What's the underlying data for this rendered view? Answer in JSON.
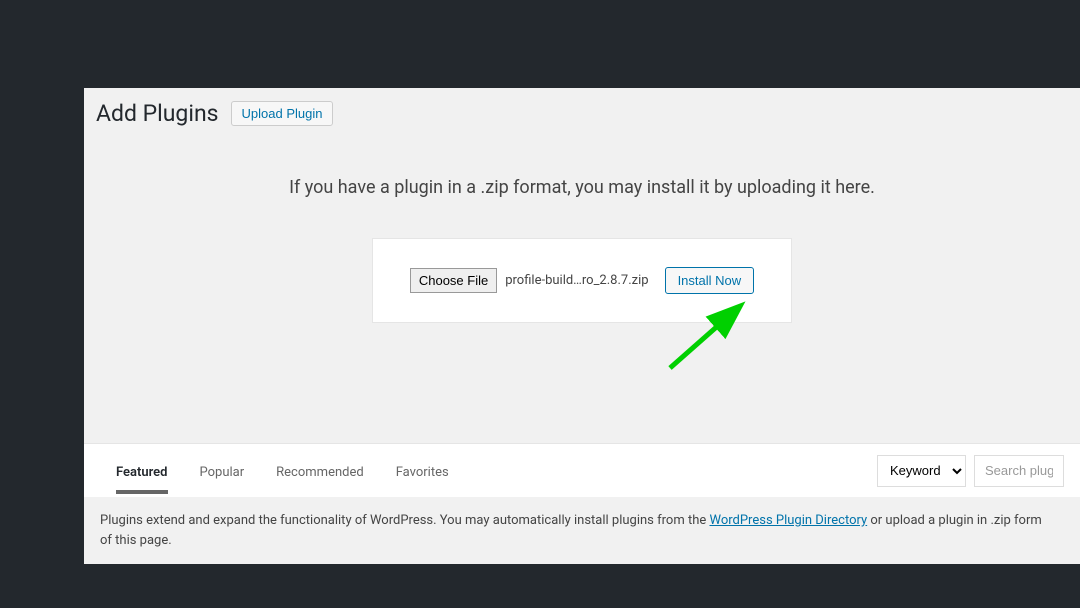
{
  "header": {
    "title": "Add Plugins",
    "upload_button": "Upload Plugin"
  },
  "upload": {
    "instruction": "If you have a plugin in a .zip format, you may install it by uploading it here.",
    "choose_file_label": "Choose File",
    "filename": "profile-build…ro_2.8.7.zip",
    "install_button": "Install Now"
  },
  "tabs": [
    {
      "label": "Featured",
      "active": true
    },
    {
      "label": "Popular",
      "active": false
    },
    {
      "label": "Recommended",
      "active": false
    },
    {
      "label": "Favorites",
      "active": false
    }
  ],
  "filter": {
    "keyword_label": "Keyword",
    "search_placeholder": "Search plug"
  },
  "footer": {
    "text_before": "Plugins extend and expand the functionality of WordPress. You may automatically install plugins from the ",
    "link_text": "WordPress Plugin Directory",
    "text_after": " or upload a plugin in .zip form",
    "text_line2": "of this page."
  }
}
